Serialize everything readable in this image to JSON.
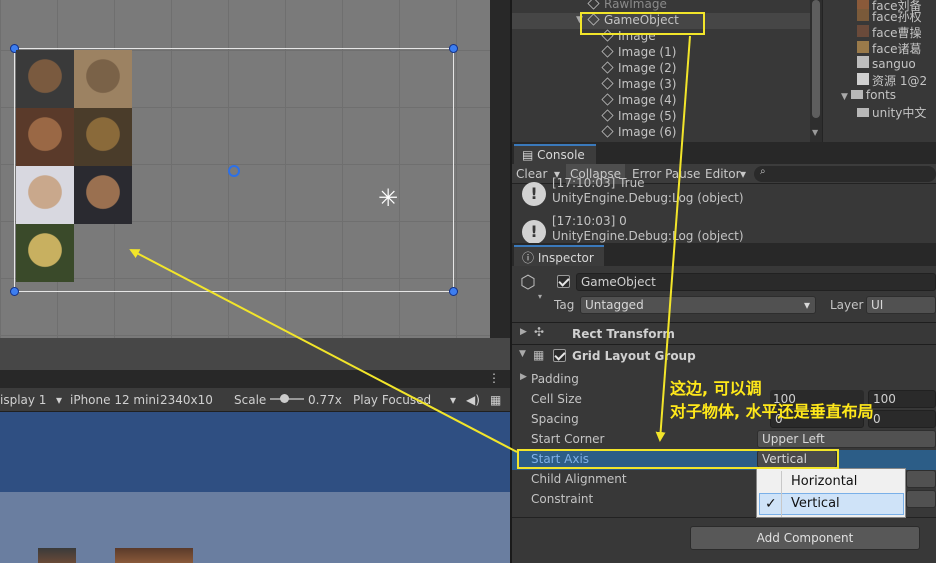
{
  "scene": {
    "faces": [
      {
        "color_top": "#3a3a3a",
        "color_bottom": "#7a5a3f"
      },
      {
        "color_top": "#5a3a2a",
        "color_bottom": "#9a6845"
      },
      {
        "color_top": "#d8d8e0",
        "color_bottom": "#c9a88c"
      },
      {
        "color_top": "#3a4a2a",
        "color_bottom": "#c8b060"
      },
      {
        "color_top": "#9c8262",
        "color_bottom": "#7a6248"
      },
      {
        "color_top": "#4a3c2a",
        "color_bottom": "#8a6a3a"
      },
      {
        "color_top": "#2a2a30",
        "color_bottom": "#9a7050"
      }
    ]
  },
  "game_toolbar": {
    "display": "isplay 1",
    "device": "iPhone 12 mini",
    "resolution": "2340x10",
    "scale_label": "Scale",
    "scale_value": "0.77x",
    "play_mode": "Play Focused"
  },
  "hierarchy": {
    "items": [
      "RawImage",
      "GameObject",
      "Image",
      "Image (1)",
      "Image (2)",
      "Image (3)",
      "Image (4)",
      "Image (5)",
      "Image (6)"
    ]
  },
  "project": {
    "items": [
      "face刘备",
      "face孙权",
      "face曹操",
      "face诸葛",
      "sanguo",
      "资源 1@2",
      "fonts",
      "unity中文"
    ]
  },
  "console": {
    "tab": "Console",
    "clear": "Clear",
    "collapse": "Collapse",
    "error_pause": "Error Pause",
    "editor": "Editor",
    "logs": [
      {
        "line1": "[17:10:03] True",
        "line2": "UnityEngine.Debug:Log (object)"
      },
      {
        "line1": "[17:10:03] 0",
        "line2": "UnityEngine.Debug:Log (object)"
      }
    ]
  },
  "inspector": {
    "tab": "Inspector",
    "object_name": "GameObject",
    "tag_label": "Tag",
    "tag_value": "Untagged",
    "layer_label": "Layer",
    "layer_value": "UI",
    "rect_transform": "Rect Transform",
    "grid_layout": "Grid Layout Group",
    "props": {
      "padding": "Padding",
      "cell_size": "Cell Size",
      "cell_x": "100",
      "cell_y": "100",
      "spacing": "Spacing",
      "spacing_x": "0",
      "spacing_y": "0",
      "start_corner": "Start Corner",
      "start_corner_value": "Upper Left",
      "start_axis": "Start Axis",
      "start_axis_value": "Vertical",
      "child_alignment": "Child Alignment",
      "constraint": "Constraint"
    },
    "add_component": "Add Component"
  },
  "dropdown": {
    "options": [
      "Horizontal",
      "Vertical"
    ],
    "selected": "Vertical"
  },
  "annotation": {
    "line1": "这边, 可以调",
    "line2": "对子物体, 水平还是垂直布局"
  },
  "colors": {
    "highlight": "#f2e52a",
    "selection": "#2c5d87",
    "accent": "#3a79bb"
  }
}
